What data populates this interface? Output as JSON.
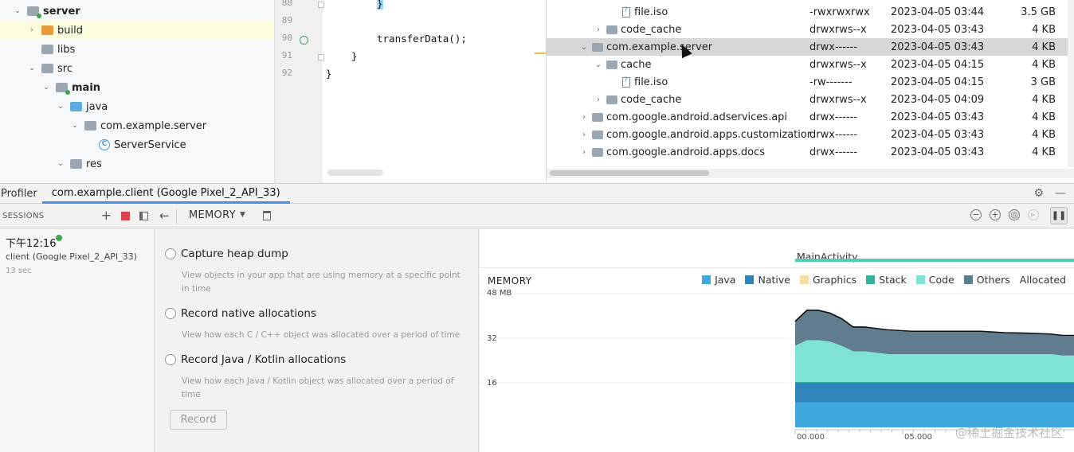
{
  "project": {
    "items": [
      {
        "label": "server",
        "chev": "⌄",
        "icon": "gray",
        "bold": true,
        "dot": true,
        "level": 0
      },
      {
        "label": "build",
        "chev": "›",
        "icon": "orange",
        "bold": false,
        "level": 1,
        "selected": true
      },
      {
        "label": "libs",
        "chev": "",
        "icon": "gray",
        "bold": false,
        "level": 1
      },
      {
        "label": "src",
        "chev": "⌄",
        "icon": "gray",
        "bold": false,
        "level": 1
      },
      {
        "label": "main",
        "chev": "⌄",
        "icon": "gray",
        "bold": true,
        "dot": true,
        "level": 2
      },
      {
        "label": "java",
        "chev": "⌄",
        "icon": "blue",
        "bold": false,
        "level": 3
      },
      {
        "label": "com.example.server",
        "chev": "⌄",
        "icon": "gray",
        "bold": false,
        "level": 4
      },
      {
        "label": "ServerService",
        "chev": "",
        "icon": "class",
        "bold": false,
        "level": 5
      },
      {
        "label": "res",
        "chev": "⌄",
        "icon": "gray",
        "bold": false,
        "level": 3
      }
    ]
  },
  "editor": {
    "line_numbers": [
      "88",
      "89",
      "90",
      "91",
      "92"
    ],
    "lines": [
      {
        "text": "}",
        "indent": 2,
        "highlight": true
      },
      {
        "text": "",
        "indent": 0
      },
      {
        "text": "transferData();",
        "indent": 2
      },
      {
        "text": "}",
        "indent": 1
      },
      {
        "text": "}",
        "indent": 0
      }
    ]
  },
  "device_explorer": {
    "rows": [
      {
        "name": "file.iso",
        "type": "file",
        "level": 3,
        "chev": "",
        "perm": "-rwxrwxrwx",
        "date": "2023-04-05 03:44",
        "size": "3.5 GB"
      },
      {
        "name": "code_cache",
        "type": "folder",
        "level": 2,
        "chev": "›",
        "perm": "drwxrws--x",
        "date": "2023-04-05 03:43",
        "size": "4 KB"
      },
      {
        "name": "com.example.server",
        "type": "folder",
        "level": 1,
        "chev": "⌄",
        "perm": "drwx------",
        "date": "2023-04-05 03:43",
        "size": "4 KB",
        "highlight": true
      },
      {
        "name": "cache",
        "type": "folder",
        "level": 2,
        "chev": "⌄",
        "perm": "drwxrws--x",
        "date": "2023-04-05 04:15",
        "size": "4 KB"
      },
      {
        "name": "file.iso",
        "type": "file",
        "level": 3,
        "chev": "",
        "perm": "-rw-------",
        "date": "2023-04-05 04:15",
        "size": "3 GB"
      },
      {
        "name": "code_cache",
        "type": "folder",
        "level": 2,
        "chev": "›",
        "perm": "drwxrws--x",
        "date": "2023-04-05 04:09",
        "size": "4 KB"
      },
      {
        "name": "com.google.android.adservices.api",
        "type": "folder",
        "level": 1,
        "chev": "›",
        "perm": "drwx------",
        "date": "2023-04-05 03:43",
        "size": "4 KB"
      },
      {
        "name": "com.google.android.apps.customizatior",
        "type": "folder",
        "level": 1,
        "chev": "›",
        "perm": "drwx------",
        "date": "2023-04-05 03:43",
        "size": "4 KB"
      },
      {
        "name": "com.google.android.apps.docs",
        "type": "folder",
        "level": 1,
        "chev": "›",
        "perm": "drwx------",
        "date": "2023-04-05 03:43",
        "size": "4 KB"
      }
    ]
  },
  "profiler": {
    "tab_profiler": "Profiler",
    "tab_session": "com.example.client (Google Pixel_2_API_33)"
  },
  "sessions": {
    "title": "SESSIONS",
    "time": "下午12:16",
    "device": "client (Google Pixel_2_API_33)",
    "duration": "13 sec"
  },
  "toolbar": {
    "dropdown_label": "MEMORY"
  },
  "options": [
    {
      "title": "Capture heap dump",
      "desc": "View objects in your app that are using memory at a specific point in time"
    },
    {
      "title": "Record native allocations",
      "desc": "View how each C / C++ object was allocated over a period of time"
    },
    {
      "title": "Record Java / Kotlin allocations",
      "desc": "View how each Java / Kotlin object was allocated over a period of time"
    }
  ],
  "record_label": "Record",
  "chart_data": {
    "type": "area",
    "title": "MEMORY",
    "activity_label": "MainActivity",
    "y_ticks": [
      "48 MB",
      "32",
      "16"
    ],
    "x_ticks": [
      "00.000",
      "05.000"
    ],
    "ylim": [
      0,
      48
    ],
    "x": [
      0.0,
      0.5,
      1.0,
      1.5,
      2.0,
      2.5,
      3.0,
      4.0,
      5.0,
      6.0,
      7.0,
      8.0,
      9.0,
      10.0,
      11.0,
      11.5,
      12.0
    ],
    "series": [
      {
        "name": "Java",
        "color": "#3fa9dd",
        "values": [
          9,
          9,
          9,
          9,
          9,
          9,
          9,
          9,
          9,
          9,
          9,
          9,
          9,
          9,
          9,
          9,
          9
        ]
      },
      {
        "name": "Native",
        "color": "#2f84b9",
        "values": [
          7,
          7,
          7,
          7,
          7,
          7,
          7,
          7,
          7,
          7,
          7,
          7,
          7,
          7,
          7,
          7,
          7
        ]
      },
      {
        "name": "Graphics",
        "color": "#f1e0a6",
        "values": [
          0,
          0,
          0,
          0,
          0,
          0,
          0,
          0,
          0,
          0,
          0,
          0,
          0,
          0,
          0,
          0,
          0
        ]
      },
      {
        "name": "Stack",
        "color": "#34b19b",
        "values": [
          0.3,
          0.3,
          0.3,
          0.3,
          0.3,
          0.3,
          0.3,
          0.3,
          0.3,
          0.3,
          0.3,
          0.3,
          0.3,
          0.3,
          0.3,
          0.3,
          0.3
        ]
      },
      {
        "name": "Code",
        "color": "#7fe3d4",
        "values": [
          13,
          15,
          15,
          14.5,
          13,
          11,
          11,
          10,
          10,
          10,
          10,
          10,
          10,
          10,
          10,
          9.5,
          9.5
        ]
      },
      {
        "name": "Others",
        "color": "#607c8e",
        "values": [
          9,
          11,
          11,
          10.5,
          10,
          9,
          9,
          8.5,
          8,
          8,
          8,
          8,
          7.7,
          7.5,
          7.3,
          7.0,
          7.0
        ]
      },
      {
        "name": "Allocated",
        "color": "#111111",
        "values": [
          38,
          42,
          42,
          41,
          39,
          36,
          36,
          35,
          34.5,
          34.5,
          34.5,
          34.5,
          34,
          33.8,
          33.5,
          33,
          33
        ]
      }
    ]
  },
  "watermark": "@稀土掘金技术社区"
}
